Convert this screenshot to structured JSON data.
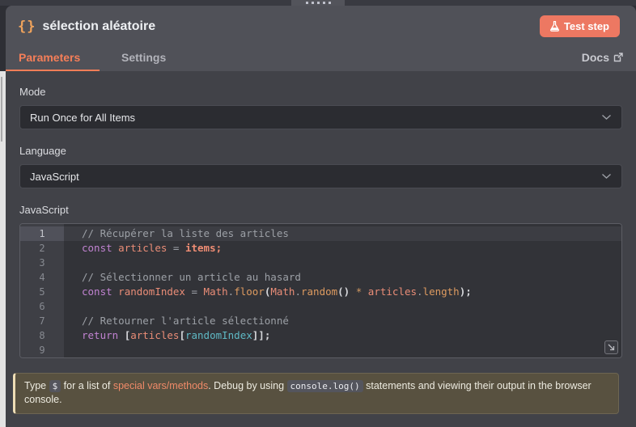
{
  "header": {
    "icon": "{}",
    "title": "sélection aléatoire",
    "test_button_label": "Test step"
  },
  "tabs": [
    {
      "label": "Parameters",
      "active": true
    },
    {
      "label": "Settings",
      "active": false
    }
  ],
  "docs_link_label": "Docs",
  "fields": {
    "mode": {
      "label": "Mode",
      "value": "Run Once for All Items"
    },
    "language": {
      "label": "Language",
      "value": "JavaScript"
    },
    "code": {
      "label": "JavaScript"
    }
  },
  "editor": {
    "language": "JavaScript",
    "lines": [
      {
        "num": 1,
        "active": true,
        "tokens": [
          {
            "t": "// Récupérer la liste des articles",
            "c": "comment"
          }
        ]
      },
      {
        "num": 2,
        "active": false,
        "tokens": [
          {
            "t": "const",
            "c": "kw"
          },
          {
            "t": " ",
            "c": "op"
          },
          {
            "t": "articles",
            "c": "var"
          },
          {
            "t": " = ",
            "c": "op"
          },
          {
            "t": "items;",
            "c": "special"
          }
        ]
      },
      {
        "num": 3,
        "active": false,
        "tokens": []
      },
      {
        "num": 4,
        "active": false,
        "tokens": [
          {
            "t": "// Sélectionner un article au hasard",
            "c": "comment"
          }
        ]
      },
      {
        "num": 5,
        "active": false,
        "tokens": [
          {
            "t": "const",
            "c": "kw"
          },
          {
            "t": " ",
            "c": "op"
          },
          {
            "t": "randomIndex",
            "c": "var"
          },
          {
            "t": " = ",
            "c": "op"
          },
          {
            "t": "Math",
            "c": "var"
          },
          {
            "t": ".",
            "c": "op"
          },
          {
            "t": "floor",
            "c": "prop"
          },
          {
            "t": "(",
            "c": "pun"
          },
          {
            "t": "Math",
            "c": "var"
          },
          {
            "t": ".",
            "c": "op"
          },
          {
            "t": "random",
            "c": "prop"
          },
          {
            "t": "()",
            "c": "pun"
          },
          {
            "t": " * ",
            "c": "star"
          },
          {
            "t": "articles",
            "c": "var"
          },
          {
            "t": ".",
            "c": "op"
          },
          {
            "t": "length",
            "c": "prop"
          },
          {
            "t": ");",
            "c": "pun"
          }
        ]
      },
      {
        "num": 6,
        "active": false,
        "tokens": []
      },
      {
        "num": 7,
        "active": false,
        "tokens": [
          {
            "t": "// Retourner l'article sélectionné",
            "c": "comment"
          }
        ]
      },
      {
        "num": 8,
        "active": false,
        "tokens": [
          {
            "t": "return",
            "c": "kw"
          },
          {
            "t": " ",
            "c": "op"
          },
          {
            "t": "[",
            "c": "pun"
          },
          {
            "t": "articles",
            "c": "var"
          },
          {
            "t": "[",
            "c": "pun"
          },
          {
            "t": "randomIndex",
            "c": "cyan"
          },
          {
            "t": "]];",
            "c": "pun"
          }
        ]
      },
      {
        "num": 9,
        "active": false,
        "tokens": []
      }
    ]
  },
  "notice": {
    "segments": [
      {
        "text": "Type ",
        "style": "plain"
      },
      {
        "text": "$",
        "style": "code"
      },
      {
        "text": " for a list of ",
        "style": "plain"
      },
      {
        "text": "special vars/methods",
        "style": "link"
      },
      {
        "text": ". Debug by using ",
        "style": "plain"
      },
      {
        "text": "console.log()",
        "style": "code"
      },
      {
        "text": " statements and viewing their output in the browser console.",
        "style": "plain"
      }
    ]
  },
  "colors": {
    "accent_orange": "#f57e58",
    "test_button": "#ed7862",
    "panel_header_bg": "#505158",
    "content_bg": "#414248",
    "editor_bg": "#323338",
    "notice_bg": "#585140",
    "notice_border_left": "#eeddb5",
    "notice_link": "#f08a68",
    "syntax": {
      "comment": "#9ca0a6",
      "keyword": "#c183d1",
      "variable": "#ea8d77",
      "property": "#de9b60",
      "special_var": "#ef8d74",
      "index_usage": "#5fb9c5",
      "punctuation": "#d6d7db"
    }
  }
}
